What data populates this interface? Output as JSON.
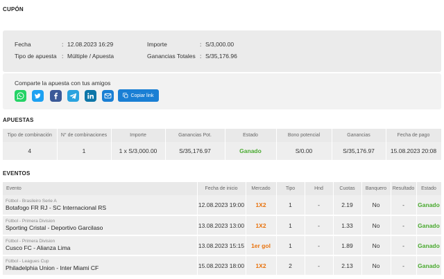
{
  "coupon": {
    "title": "CUPÓN",
    "fields": [
      {
        "label": "Fecha",
        "value": "12.08.2023 16:29"
      },
      {
        "label": "Tipo de apuesta",
        "value": "Múltiple / Apuesta"
      },
      {
        "label": "Importe",
        "value": "S/3,000.00"
      },
      {
        "label": "Ganancias Totales",
        "value": "S/35,176.96"
      }
    ],
    "separator": ":"
  },
  "share": {
    "label": "Comparte la apuesta con tus amigos",
    "icons": [
      {
        "name": "whatsapp-icon",
        "color": "#25d366"
      },
      {
        "name": "twitter-icon",
        "color": "#1da1f2"
      },
      {
        "name": "facebook-icon",
        "color": "#3b5998"
      },
      {
        "name": "telegram-icon",
        "color": "#2aa3df"
      },
      {
        "name": "linkedin-icon",
        "color": "#0e76a8"
      },
      {
        "name": "email-icon",
        "color": "#1a7fd4"
      }
    ],
    "copy_label": "Copiar link"
  },
  "bets": {
    "title": "APUESTAS",
    "headers": [
      "Tipo de combinación",
      "N° de combinaciones",
      "Importe",
      "Ganancias Pot.",
      "Estado",
      "Bono potencial",
      "Ganancias",
      "Fecha de pago"
    ],
    "row": [
      "4",
      "1",
      "1 x S/3,000.00",
      "S/35,176.97",
      "Ganado",
      "S/0.00",
      "S/35,176.97",
      "15.08.2023 20:08"
    ]
  },
  "events": {
    "title": "EVENTOS",
    "headers": [
      "Evento",
      "Fecha de inicio",
      "Mercado",
      "Tipo",
      "Hnd",
      "Cuotas",
      "Banquero",
      "Resultado",
      "Estado"
    ],
    "rows": [
      {
        "league": "Fútbol - Brasileiro Serie A",
        "match": "Botafogo FR RJ - SC Internacional RS",
        "date": "12.08.2023 19:00",
        "market": "1X2",
        "type": "1",
        "hnd": "-",
        "odds": "2.19",
        "banker": "No",
        "result": "-",
        "status": "Ganado"
      },
      {
        "league": "Fútbol - Primera Division",
        "match": "Sporting Cristal - Deportivo Garcilaso",
        "date": "13.08.2023 13:00",
        "market": "1X2",
        "type": "1",
        "hnd": "-",
        "odds": "1.33",
        "banker": "No",
        "result": "-",
        "status": "Ganado"
      },
      {
        "league": "Fútbol - Primera Division",
        "match": "Cusco FC - Alianza Lima",
        "date": "13.08.2023 15:15",
        "market": "1er gol",
        "type": "1",
        "hnd": "-",
        "odds": "1.89",
        "banker": "No",
        "result": "-",
        "status": "Ganado"
      },
      {
        "league": "Fútbol - Leagues Cup",
        "match": "Philadelphia Union - Inter Miami CF",
        "date": "15.08.2023 18:00",
        "market": "1X2",
        "type": "2",
        "hnd": "-",
        "odds": "2.13",
        "banker": "No",
        "result": "-",
        "status": "Ganado"
      }
    ]
  },
  "colors": {
    "accent": "#1a7fd4",
    "won": "#4aaa30",
    "market": "#e8720c"
  }
}
